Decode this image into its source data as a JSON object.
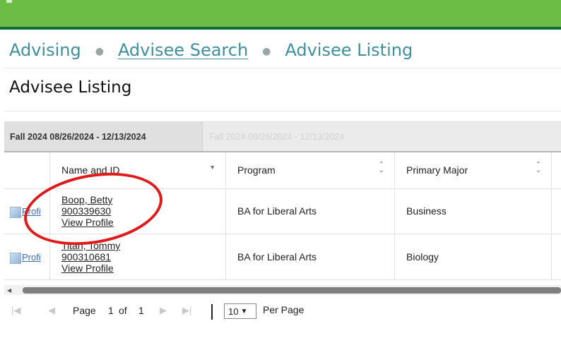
{
  "breadcrumb": {
    "items": [
      "Advising",
      "Advisee Search",
      "Advisee Listing"
    ]
  },
  "page": {
    "title": "Advisee Listing"
  },
  "terms": {
    "active": "Fall 2024 08/26/2024 - 12/13/2024",
    "inactive": "Fall 2024 08/26/2024 - 12/13/2024"
  },
  "table": {
    "columns": [
      "Name and ID",
      "Program",
      "Primary Major"
    ],
    "rows": [
      {
        "img_alt": "Profi",
        "name": "Boop, Betty",
        "id": "900339630",
        "view": "View Profile",
        "program": "BA for Liberal Arts",
        "major": "Business"
      },
      {
        "img_alt": "Profi",
        "name": "Titan, Tommy",
        "id": "900310681",
        "view": "View Profile",
        "program": "BA for Liberal Arts",
        "major": "Biology"
      }
    ]
  },
  "pager": {
    "page_label": "Page",
    "current": "1",
    "of_label": "of",
    "total": "1",
    "page_size": "10",
    "per_page_label": "Per Page"
  },
  "icons": {
    "first": "first-page-icon",
    "prev": "prev-page-icon",
    "next": "next-page-icon",
    "last": "last-page-icon",
    "sort": "sort-icon"
  },
  "colors": {
    "brand_green": "#6cbd45",
    "brand_dark": "#0d6b3a",
    "link_teal": "#3f8f9e",
    "highlight_circle": "#e01a1a"
  }
}
